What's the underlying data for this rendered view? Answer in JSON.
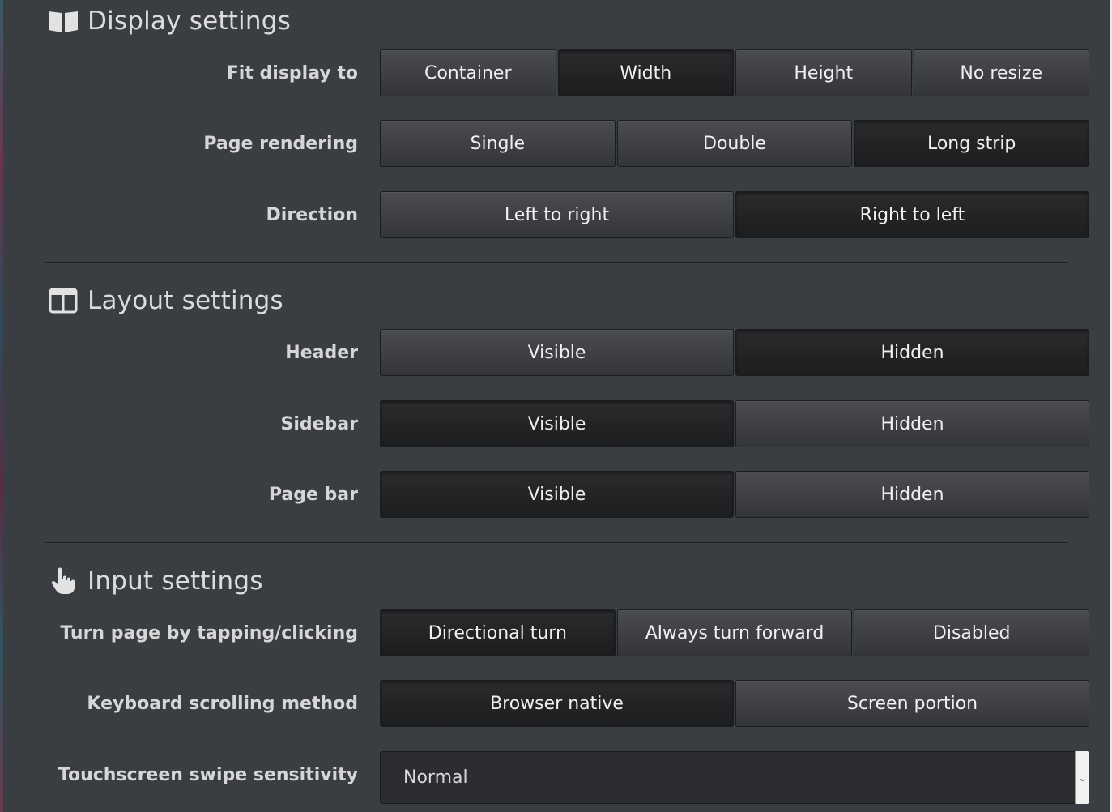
{
  "display": {
    "title": "Display settings",
    "title_icon": "open-book-icon",
    "fit": {
      "label": "Fit display to",
      "options": [
        "Container",
        "Width",
        "Height",
        "No resize"
      ],
      "selected": "Width"
    },
    "rendering": {
      "label": "Page rendering",
      "options": [
        "Single",
        "Double",
        "Long strip"
      ],
      "selected": "Long strip"
    },
    "direction": {
      "label": "Direction",
      "options": [
        "Left to right",
        "Right to left"
      ],
      "selected": "Right to left"
    }
  },
  "layout": {
    "title": "Layout settings",
    "title_icon": "columns-icon",
    "header": {
      "label": "Header",
      "options": [
        "Visible",
        "Hidden"
      ],
      "selected": "Hidden"
    },
    "sidebar": {
      "label": "Sidebar",
      "options": [
        "Visible",
        "Hidden"
      ],
      "selected": "Visible"
    },
    "pagebar": {
      "label": "Page bar",
      "options": [
        "Visible",
        "Hidden"
      ],
      "selected": "Visible"
    }
  },
  "input": {
    "title": "Input settings",
    "title_icon": "pointing-hand-icon",
    "tap": {
      "label": "Turn page by tapping/clicking",
      "options": [
        "Directional turn",
        "Always turn forward",
        "Disabled"
      ],
      "selected": "Directional turn"
    },
    "keyboard": {
      "label": "Keyboard scrolling method",
      "options": [
        "Browser native",
        "Screen portion"
      ],
      "selected": "Browser native"
    },
    "swipe": {
      "label": "Touchscreen swipe sensitivity",
      "value": "Normal"
    }
  },
  "colors": {
    "background": "#3a3d42",
    "button": "#3d3f43",
    "button_active": "#222325"
  }
}
